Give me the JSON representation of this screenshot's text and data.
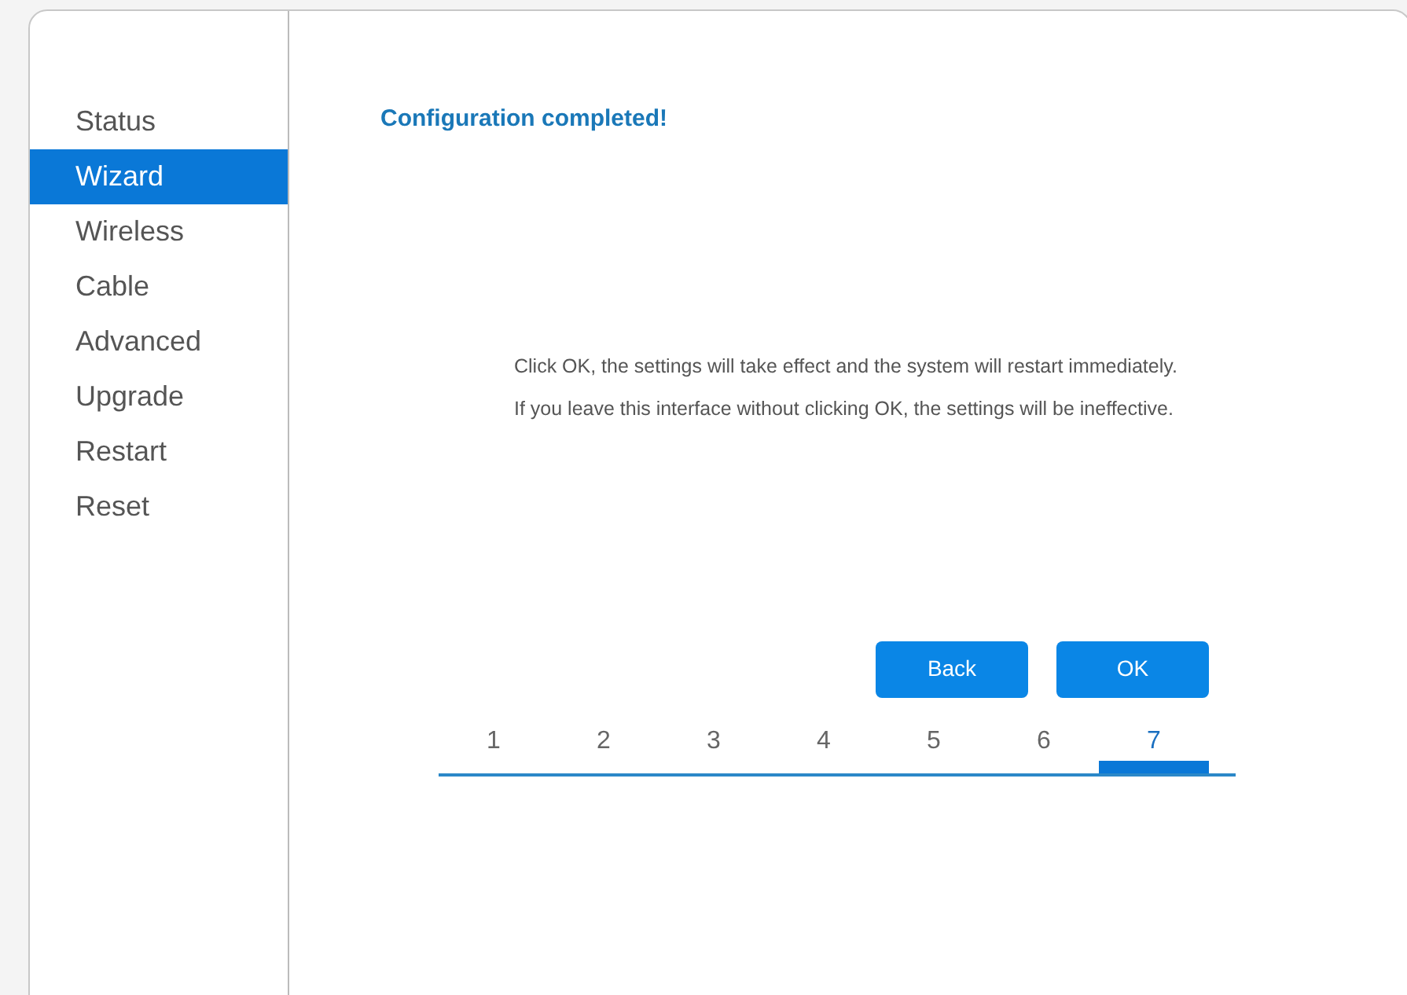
{
  "sidebar": {
    "items": [
      {
        "label": "Status",
        "selected": false
      },
      {
        "label": "Wizard",
        "selected": true
      },
      {
        "label": "Wireless",
        "selected": false
      },
      {
        "label": "Cable",
        "selected": false
      },
      {
        "label": "Advanced",
        "selected": false
      },
      {
        "label": "Upgrade",
        "selected": false
      },
      {
        "label": "Restart",
        "selected": false
      },
      {
        "label": "Reset",
        "selected": false
      }
    ]
  },
  "title": "Configuration completed!",
  "paragraphs": [
    "Click OK, the settings will take effect and the system will restart immediately.",
    "If you leave this interface without clicking OK, the settings will be ineffective."
  ],
  "buttons": [
    "Back",
    "OK"
  ],
  "steps": [
    {
      "label": "1",
      "selected": false
    },
    {
      "label": "2",
      "selected": false
    },
    {
      "label": "3",
      "selected": false
    },
    {
      "label": "4",
      "selected": false
    },
    {
      "label": "5",
      "selected": false
    },
    {
      "label": "6",
      "selected": false
    },
    {
      "label": "7",
      "selected": true
    }
  ]
}
